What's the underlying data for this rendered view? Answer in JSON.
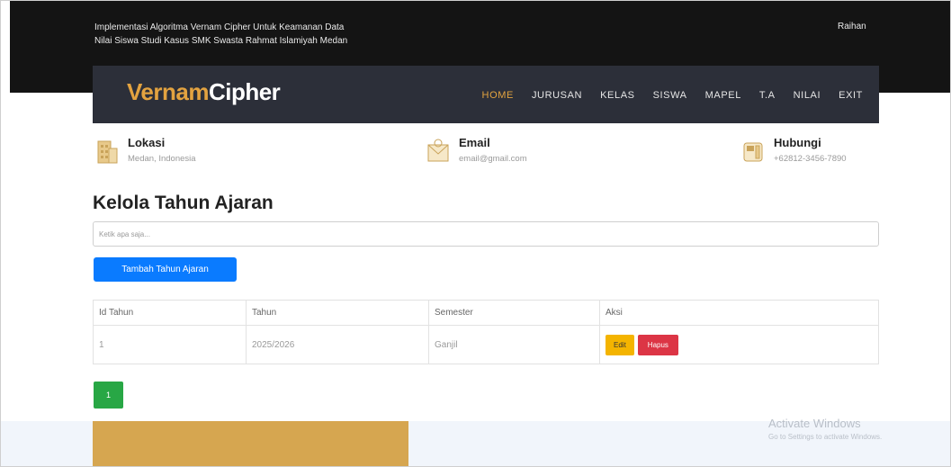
{
  "header": {
    "app_title_line1": "Implementasi Algoritma Vernam Cipher Untuk Keamanan Data",
    "app_title_line2": "Nilai Siswa Studi Kasus SMK Swasta Rahmat Islamiyah Medan",
    "user": "Raihan"
  },
  "brand": {
    "part1": "Vernam",
    "part2": "Cipher"
  },
  "nav": {
    "items": [
      {
        "label": "HOME",
        "active": true
      },
      {
        "label": "JURUSAN"
      },
      {
        "label": "KELAS"
      },
      {
        "label": "SISWA"
      },
      {
        "label": "MAPEL"
      },
      {
        "label": "T.A"
      },
      {
        "label": "NILAI"
      },
      {
        "label": "EXIT"
      }
    ]
  },
  "info": {
    "lokasi": {
      "label": "Lokasi",
      "value": "Medan, Indonesia",
      "icon": "building-icon"
    },
    "email": {
      "label": "Email",
      "value": "email@gmail.com",
      "icon": "envelope-icon"
    },
    "hubungi": {
      "label": "Hubungi",
      "value": "+62812-3456-7890",
      "icon": "phone-icon"
    }
  },
  "page": {
    "title": "Kelola Tahun Ajaran",
    "search_placeholder": "Ketik apa saja...",
    "add_button": "Tambah Tahun Ajaran"
  },
  "table": {
    "columns": [
      "Id Tahun",
      "Tahun",
      "Semester",
      "Aksi"
    ],
    "rows": [
      {
        "id": "1",
        "tahun": "2025/2026",
        "semester": "Ganjil",
        "edit_label": "Edit",
        "delete_label": "Hapus"
      }
    ]
  },
  "pagination": {
    "current": "1"
  },
  "watermark": {
    "line1": "Activate Windows",
    "line2": "Go to Settings to activate Windows."
  },
  "colors": {
    "accent": "#e3a340",
    "navbar": "#2c2f39",
    "primary": "#0a7bff",
    "success": "#28a745",
    "danger": "#dc3545",
    "warning": "#f4b400"
  }
}
